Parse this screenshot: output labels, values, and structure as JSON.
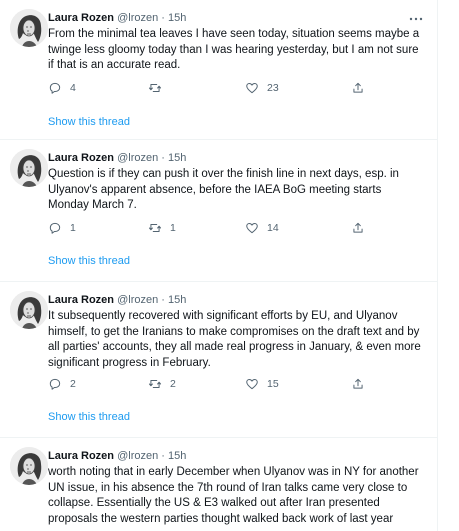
{
  "tweets": [
    {
      "author": "Laura Rozen",
      "handle": "@lrozen",
      "dot": "·",
      "time": "15h",
      "text": "From the minimal tea leaves I have seen today, situation seems maybe a twinge less gloomy today than I was hearing yesterday, but I am not sure if that is an accurate read.",
      "replies": "4",
      "retweets": "",
      "likes": "23",
      "show_thread": "Show this thread"
    },
    {
      "author": "Laura Rozen",
      "handle": "@lrozen",
      "dot": "·",
      "time": "15h",
      "text": "Question is if they can push it over the finish line in next days, esp. in Ulyanov's apparent absence, before the IAEA BoG meeting starts Monday March 7.",
      "replies": "1",
      "retweets": "1",
      "likes": "14",
      "show_thread": "Show this thread"
    },
    {
      "author": "Laura Rozen",
      "handle": "@lrozen",
      "dot": "·",
      "time": "15h",
      "text": "It subsequently recovered with significant efforts by EU, and Ulyanov himself, to get the Iranians to make compromises on the draft text and by all parties' accounts, they all made real progress in January, & even more significant progress in February.",
      "replies": "2",
      "retweets": "2",
      "likes": "15",
      "show_thread": "Show this thread"
    },
    {
      "author": "Laura Rozen",
      "handle": "@lrozen",
      "dot": "·",
      "time": "15h",
      "text": "worth noting that in early December when Ulyanov was in NY for another UN issue, in his absence the 7th round of Iran talks came very close to collapse. Essentially the US & E3 walked out after Iran presented proposals the western parties thought walked back work of last year"
    }
  ],
  "icons": {
    "reply": "reply-icon",
    "retweet": "retweet-icon",
    "like": "heart-icon",
    "share": "share-icon",
    "more": "more-icon",
    "avatar": "avatar-illustration"
  },
  "colors": {
    "link": "#1d9bf0",
    "muted": "#536471",
    "text": "#0f1419",
    "divider": "#eff3f4"
  }
}
